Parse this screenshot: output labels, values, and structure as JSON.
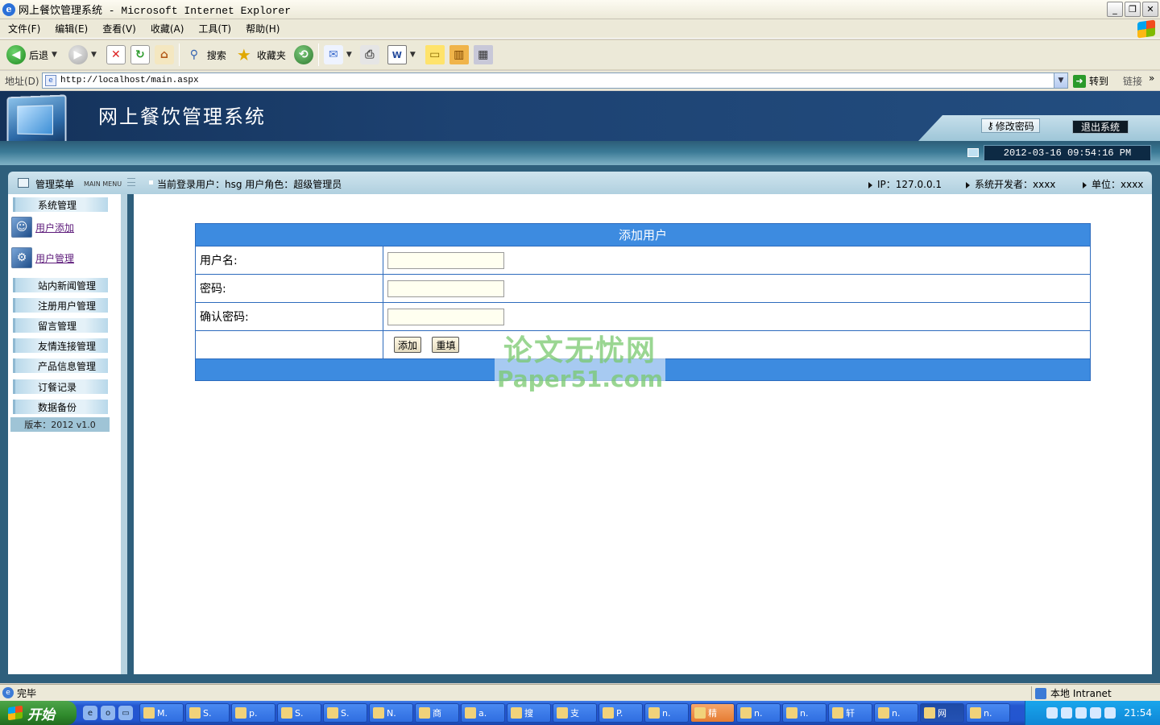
{
  "window": {
    "title": "网上餐饮管理系统 - Microsoft Internet Explorer",
    "min": "_",
    "max": "❐",
    "close": "✕"
  },
  "menubar": {
    "items": [
      "文件(F)",
      "编辑(E)",
      "查看(V)",
      "收藏(A)",
      "工具(T)",
      "帮助(H)"
    ]
  },
  "toolbar": {
    "back_label": "后退",
    "search_label": "搜索",
    "favorites_label": "收藏夹"
  },
  "address": {
    "label": "地址(D)",
    "url": "http://localhost/main.aspx",
    "go_label": "转到",
    "links_label": "链接"
  },
  "app": {
    "title": "网上餐饮管理系统",
    "change_password": "修改密码",
    "exit": "退出系统",
    "datetime": "2012-03-16 09:54:16 PM",
    "menu_title": "管理菜单",
    "menu_en": "MAIN MENU",
    "current_user": "当前登录用户：hsg   用户角色：超级管理员",
    "ip": "IP：127.0.0.1",
    "developer": "系统开发者：xxxx",
    "unit": "单位：xxxx"
  },
  "sidebar": {
    "system": "系统管理",
    "user_add": "用户添加",
    "user_manage": "用户管理",
    "items": [
      "站内新闻管理",
      "注册用户管理",
      "留言管理",
      "友情连接管理",
      "产品信息管理",
      "订餐记录",
      "数据备份"
    ],
    "version": "版本：2012 v1.0"
  },
  "form": {
    "heading": "添加用户",
    "username_label": "用户名:",
    "password_label": "密码:",
    "confirm_label": "确认密码:",
    "username_value": "",
    "password_value": "",
    "confirm_value": "",
    "add_button": "添加",
    "reset_button": "重填"
  },
  "watermark": {
    "line1": "论文无忧网",
    "line2": "Paper51.com"
  },
  "statusbar": {
    "text": "完毕",
    "zone": "本地 Intranet"
  },
  "taskbar": {
    "start": "开始",
    "tasks": [
      "M.",
      "S.",
      "p.",
      "S.",
      "S.",
      "N.",
      "商",
      "a.",
      "搜",
      "支",
      "P.",
      "n.",
      "精",
      "n.",
      "n.",
      "轩",
      "n.",
      "网",
      "n."
    ],
    "clock": "21:54"
  }
}
